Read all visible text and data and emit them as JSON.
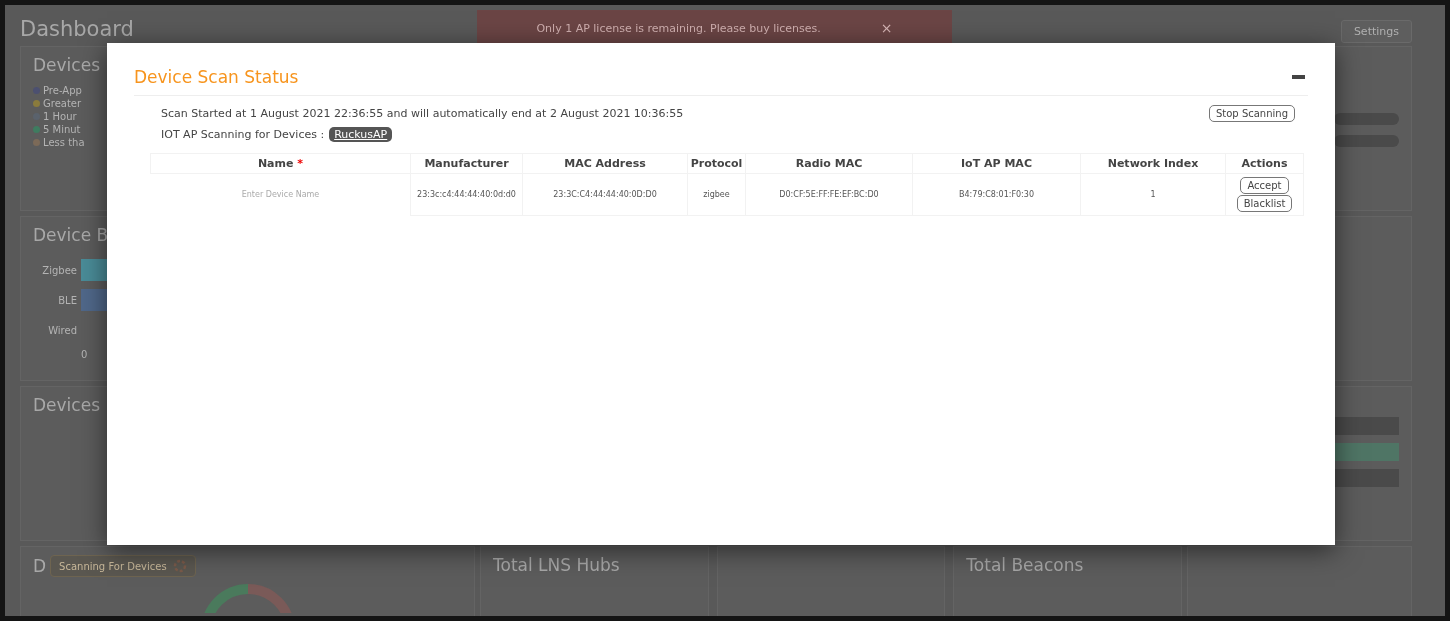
{
  "background": {
    "title": "Dashboard",
    "alert": {
      "message": "Only 1 AP license is remaining. Please buy licenses.",
      "close": "×"
    },
    "settings_button": "Settings",
    "status_card": {
      "title": "Devices",
      "legend": [
        {
          "label": "Pre-App",
          "color": "#4c5070"
        },
        {
          "label": "Greater",
          "color": "#8a7b3c"
        },
        {
          "label": "1 Hour",
          "color": "#5a626c"
        },
        {
          "label": "5 Minut",
          "color": "#3f7c60"
        },
        {
          "label": "Less tha",
          "color": "#7c6a58"
        }
      ]
    },
    "type_card": {
      "title": "Device B",
      "bars": [
        {
          "label": "Zigbee",
          "color": "#4a8c98"
        },
        {
          "label": "BLE",
          "color": "#50688a"
        },
        {
          "label": "Wired"
        }
      ],
      "axis_label": "0"
    },
    "devices_card": {
      "title": "Devices"
    },
    "scan_card": {
      "title": "D",
      "badge": "Scanning For Devices"
    },
    "hubs_card": {
      "title": "Total LNS Hubs"
    },
    "beacons_card": {
      "title": "Total Beacons"
    }
  },
  "modal": {
    "title": "Device Scan Status",
    "scan_info": "Scan Started at 1 August 2021 22:36:55 and will automatically end at 2 August 2021 10:36:55",
    "stop_button": "Stop Scanning",
    "ap_label": "IOT AP Scanning for Devices :",
    "ap_name": "RuckusAP",
    "columns": [
      {
        "label": "Name",
        "marker": "*"
      },
      {
        "label": "Manufacturer"
      },
      {
        "label": "MAC Address"
      },
      {
        "label": "Protocol"
      },
      {
        "label": "Radio MAC"
      },
      {
        "label": "IoT AP MAC"
      },
      {
        "label": "Network Index"
      },
      {
        "label": "Actions"
      }
    ],
    "rows": [
      {
        "name_placeholder": "Enter Device Name",
        "manufacturer": "23:3c:c4:44:44:40:0d:d0",
        "mac_address": "23:3C:C4:44:44:40:0D:D0",
        "protocol": "zigbee",
        "radio_mac": "D0:CF:5E:FF:FE:EF:BC:D0",
        "iot_ap_mac": "B4:79:C8:01:F0:30",
        "network_index": "1",
        "actions": [
          "Accept",
          "Blacklist"
        ]
      }
    ]
  }
}
